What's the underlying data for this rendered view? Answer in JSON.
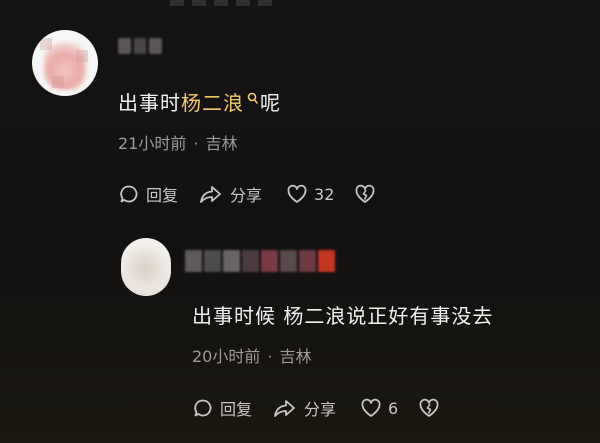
{
  "comments": [
    {
      "text_before": "出事时",
      "link_text": "杨二浪",
      "text_after": "呢",
      "time": "21小时前",
      "location": "吉林",
      "actions": {
        "reply_label": "回复",
        "share_label": "分享",
        "like_count": "32"
      }
    }
  ],
  "reply": {
    "text": "出事时候 杨二浪说正好有事没去",
    "time": "20小时前",
    "location": "吉林",
    "actions": {
      "reply_label": "回复",
      "share_label": "分享",
      "like_count": "6"
    }
  },
  "meta_separator": "·",
  "colors": {
    "link": "#f3c96b",
    "text": "#f2f0f0",
    "meta": "#9d9999",
    "background": "#141212"
  },
  "icons": [
    "search-icon",
    "comment-icon",
    "share-icon",
    "heart-icon",
    "broken-heart-icon"
  ]
}
